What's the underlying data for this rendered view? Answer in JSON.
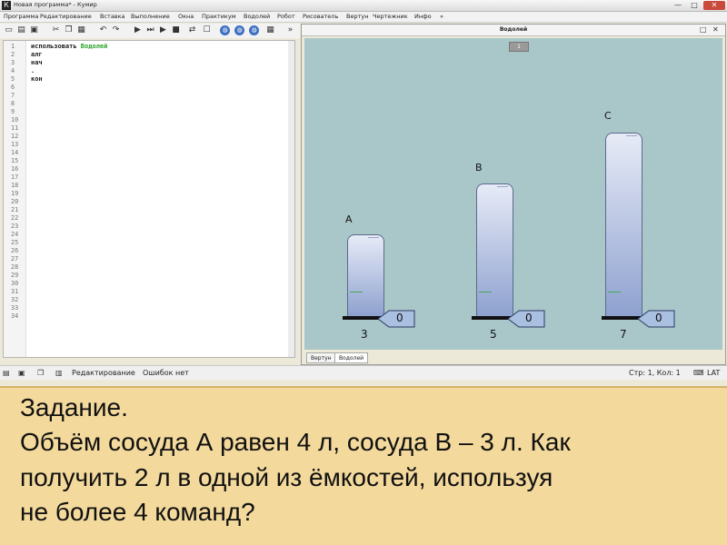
{
  "window": {
    "title": "Новая программа* - Кумир",
    "app_icon": "К",
    "controls": {
      "minimize": "—",
      "maximize": "□",
      "close": "✕"
    }
  },
  "menu": [
    "Программа",
    "Редактирование",
    "Вставка",
    "Выполнение",
    "Окна",
    "Практикум",
    "Водолей",
    "Робот",
    "Рисователь",
    "Вертун",
    "Чертежник",
    "Инфо",
    "»"
  ],
  "toolbar_icons": [
    "new-file-icon",
    "open-file-icon",
    "save-icon",
    "cut-icon",
    "copy-icon",
    "paste-icon",
    "undo-icon",
    "redo-icon",
    "run-icon",
    "step-icon",
    "step-into-icon",
    "stop-icon",
    "switch-icon",
    "empty-icon",
    "globe-icon",
    "globe2-icon",
    "globe3-icon",
    "more-icon"
  ],
  "editor": {
    "lines": [
      "1",
      "2",
      "3",
      "4",
      "5",
      "6",
      "7",
      "8",
      "9",
      "10",
      "11",
      "12",
      "13",
      "14",
      "15",
      "16",
      "17",
      "18",
      "19",
      "20",
      "21",
      "22",
      "23",
      "24",
      "25",
      "26",
      "27",
      "28",
      "29",
      "30",
      "31",
      "32",
      "33",
      "34"
    ],
    "code": {
      "line1_kw": "использовать ",
      "line1_name": "Водолей",
      "line2": "алг",
      "line3": "нач",
      "line4": ".",
      "line5": "кон"
    }
  },
  "panel": {
    "title": "Водолей",
    "page": "1",
    "tabs": [
      "Вертун",
      "Водолей"
    ],
    "accent": "#a9c6c9"
  },
  "vessels": [
    {
      "label": "A",
      "fill": "0",
      "capacity": "3"
    },
    {
      "label": "B",
      "fill": "0",
      "capacity": "5"
    },
    {
      "label": "C",
      "fill": "0",
      "capacity": "7"
    }
  ],
  "status": {
    "mode": "Редактирование",
    "errors": "Ошибок нет",
    "position": "Стр: 1, Кол: 1",
    "keyboard": "LAT"
  },
  "task": {
    "heading": "Задание.",
    "line1": "Объём сосуда А равен 4 л, сосуда В – 3 л. Как",
    "line2": "получить 2 л в одной из ёмкостей, используя",
    "line3": "не более 4 команд?"
  }
}
